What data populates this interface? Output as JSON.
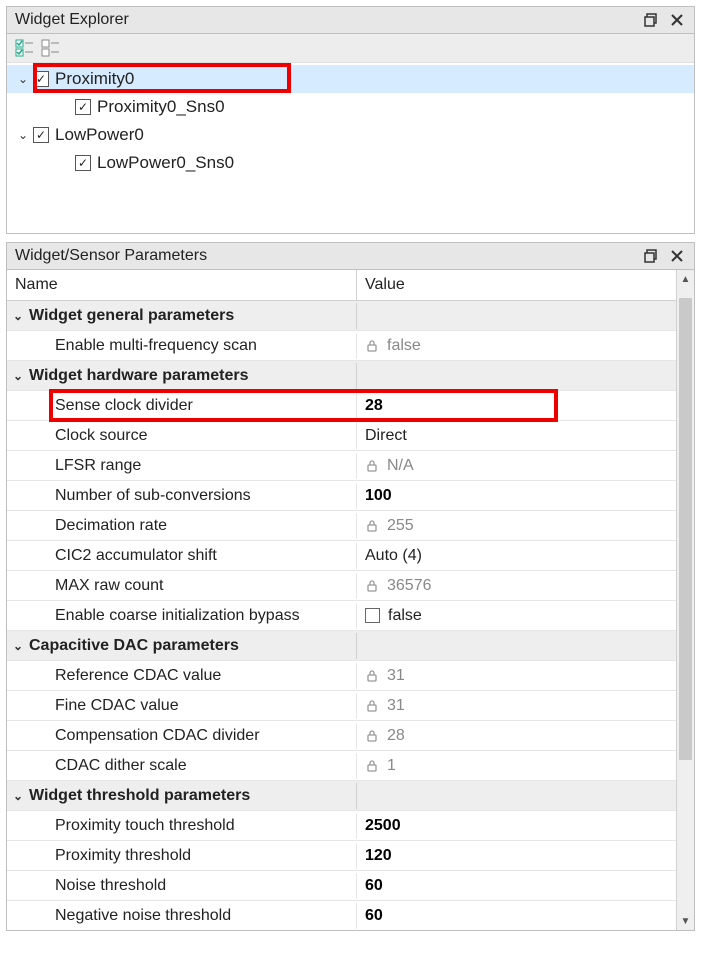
{
  "explorer": {
    "title": "Widget Explorer",
    "items": [
      {
        "label": "Proximity0",
        "depth": 0,
        "expanded": true,
        "checked": true,
        "selected": true,
        "highlight": true
      },
      {
        "label": "Proximity0_Sns0",
        "depth": 1,
        "checked": true
      },
      {
        "label": "LowPower0",
        "depth": 0,
        "expanded": true,
        "checked": true
      },
      {
        "label": "LowPower0_Sns0",
        "depth": 1,
        "checked": true
      }
    ]
  },
  "params": {
    "title": "Widget/Sensor Parameters",
    "columns": {
      "name": "Name",
      "value": "Value"
    },
    "sections": [
      {
        "title": "Widget general parameters",
        "rows": [
          {
            "name": "Enable multi-frequency scan",
            "value": "false",
            "locked": true
          }
        ]
      },
      {
        "title": "Widget hardware parameters",
        "rows": [
          {
            "name": "Sense clock divider",
            "value": "28",
            "bold": true,
            "highlight": true
          },
          {
            "name": "Clock source",
            "value": "Direct"
          },
          {
            "name": "LFSR range",
            "value": "N/A",
            "locked": true
          },
          {
            "name": "Number of sub-conversions",
            "value": "100",
            "bold": true
          },
          {
            "name": "Decimation rate",
            "value": "255",
            "locked": true
          },
          {
            "name": "CIC2 accumulator shift",
            "value": "Auto (4)"
          },
          {
            "name": "MAX raw count",
            "value": "36576",
            "locked": true
          },
          {
            "name": "Enable coarse initialization bypass",
            "value": "false",
            "checkbox": true
          }
        ]
      },
      {
        "title": "Capacitive DAC parameters",
        "rows": [
          {
            "name": "Reference CDAC value",
            "value": "31",
            "locked": true
          },
          {
            "name": "Fine CDAC value",
            "value": "31",
            "locked": true
          },
          {
            "name": "Compensation CDAC divider",
            "value": "28",
            "locked": true
          },
          {
            "name": "CDAC dither scale",
            "value": "1",
            "locked": true
          }
        ]
      },
      {
        "title": "Widget threshold parameters",
        "rows": [
          {
            "name": "Proximity touch threshold",
            "value": "2500",
            "bold": true
          },
          {
            "name": "Proximity threshold",
            "value": "120",
            "bold": true
          },
          {
            "name": "Noise threshold",
            "value": "60",
            "bold": true
          },
          {
            "name": "Negative noise threshold",
            "value": "60",
            "bold": true
          }
        ]
      }
    ]
  }
}
